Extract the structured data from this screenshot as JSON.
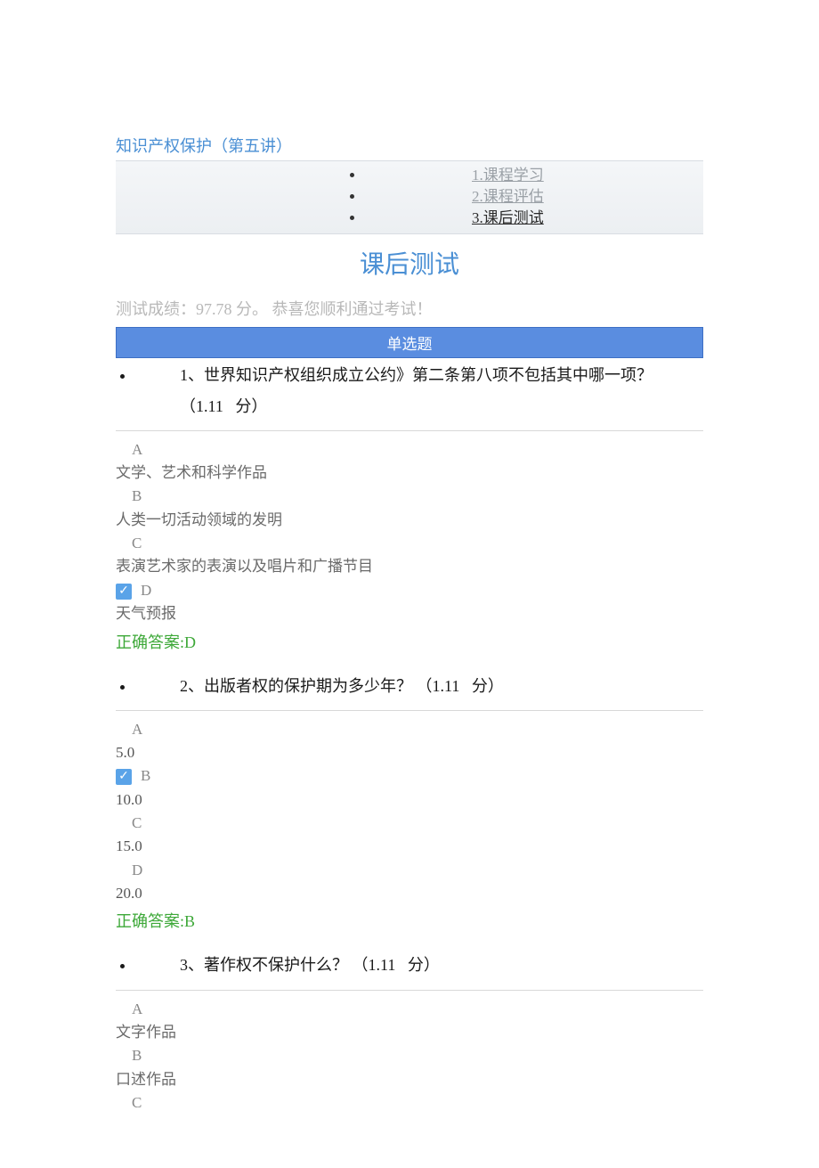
{
  "course_title": "知识产权保护（第五讲）",
  "nav": [
    {
      "label": "1.课程学习",
      "active": false
    },
    {
      "label": "2.课程评估",
      "active": false
    },
    {
      "label": "3.课后测试",
      "active": true
    }
  ],
  "section_title": "课后测试",
  "score_line": "测试成绩：97.78 分。  恭喜您顺利通过考试！",
  "banner": "单选题",
  "questions": [
    {
      "num": "1、",
      "text": "世界知识产权组织成立公约》第二条第八项不包括其中哪一项？",
      "points": "（1.11   分）",
      "options": [
        {
          "letter": "A",
          "text": "文学、艺术和科学作品",
          "checked": false
        },
        {
          "letter": "B",
          "text": "人类一切活动领域的发明",
          "checked": false
        },
        {
          "letter": "C",
          "text": "表演艺术家的表演以及唱片和广播节目",
          "checked": false
        },
        {
          "letter": "D",
          "text": "天气预报",
          "checked": true
        }
      ],
      "answer": "正确答案:D"
    },
    {
      "num": "2、",
      "text": "出版者权的保护期为多少年？ ",
      "points": "（1.11   分）",
      "options": [
        {
          "letter": "A",
          "text": "5.0",
          "checked": false
        },
        {
          "letter": "B",
          "text": "10.0",
          "checked": true
        },
        {
          "letter": "C",
          "text": "15.0",
          "checked": false
        },
        {
          "letter": "D",
          "text": "20.0",
          "checked": false
        }
      ],
      "answer": "正确答案:B"
    },
    {
      "num": "3、",
      "text": "著作权不保护什么？ ",
      "points": "（1.11   分）",
      "options": [
        {
          "letter": "A",
          "text": "文字作品",
          "checked": false
        },
        {
          "letter": "B",
          "text": "口述作品",
          "checked": false
        },
        {
          "letter": "C",
          "text": "",
          "checked": false
        }
      ],
      "answer": ""
    }
  ]
}
